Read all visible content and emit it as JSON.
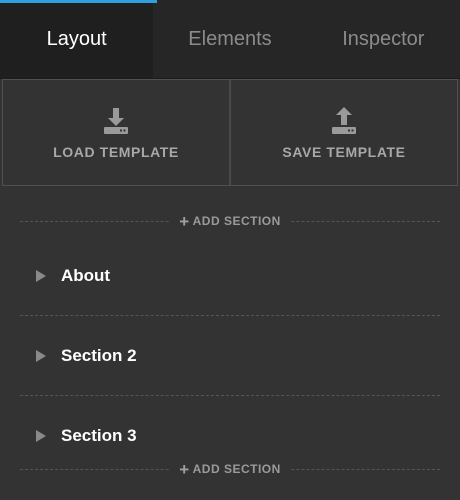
{
  "tabs": [
    {
      "label": "Layout",
      "active": true
    },
    {
      "label": "Elements",
      "active": false
    },
    {
      "label": "Inspector",
      "active": false
    }
  ],
  "template_actions": {
    "load": {
      "label": "LOAD TEMPLATE",
      "icon": "download-icon"
    },
    "save": {
      "label": "SAVE TEMPLATE",
      "icon": "upload-icon"
    }
  },
  "add_section_label": "ADD SECTION",
  "sections": [
    {
      "label": "About"
    },
    {
      "label": "Section 2"
    },
    {
      "label": "Section 3"
    }
  ],
  "colors": {
    "accent": "#2f9fe0",
    "panel_bg": "#333333",
    "tab_bar_bg": "#262626",
    "active_tab_bg": "#1f1f1f",
    "muted_text": "#a8a8a8"
  }
}
